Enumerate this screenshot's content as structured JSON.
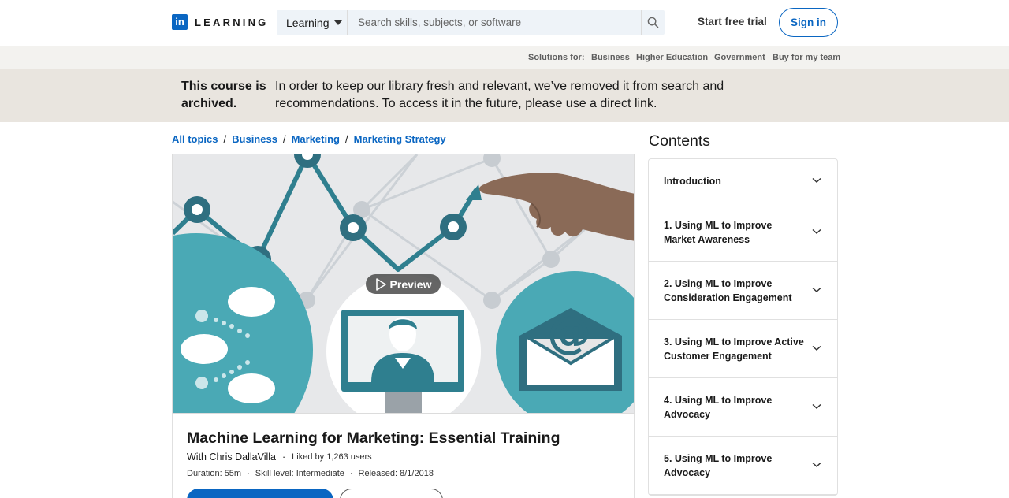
{
  "header": {
    "logo_mark": "in",
    "logo_text": "LEARNING",
    "search_scope": "Learning",
    "search_placeholder": "Search skills, subjects, or software",
    "start_trial": "Start free trial",
    "sign_in": "Sign in"
  },
  "solutions": {
    "label": "Solutions for:",
    "links": [
      "Business",
      "Higher Education",
      "Government",
      "Buy for my team"
    ]
  },
  "banner": {
    "title": "This course is archived.",
    "message": "In order to keep our library fresh and relevant, we’ve removed it from search and recommendations. To access it in the future, please use a direct link."
  },
  "breadcrumb": [
    "All topics",
    "Business",
    "Marketing",
    "Marketing Strategy"
  ],
  "hero": {
    "preview_label": "Preview"
  },
  "course": {
    "title": "Machine Learning for Marketing: Essential Training",
    "instructor": "With Chris DallaVilla",
    "likes": "Liked by 1,263 users",
    "duration": "Duration: 55m",
    "skill_level": "Skill level: Intermediate",
    "released": "Released: 8/1/2018"
  },
  "contents": {
    "heading": "Contents",
    "items": [
      "Introduction",
      "1. Using ML to Improve Market Awareness",
      "2. Using ML to Improve Consideration Engagement",
      "3. Using ML to Improve Active Customer Engagement",
      "4. Using ML to Improve Advocacy",
      "5. Using ML to Improve Advocacy"
    ]
  },
  "colors": {
    "brand_blue": "#0a66c2",
    "teal": "#4aa9b5",
    "dark_teal": "#2f6f80",
    "banner_bg": "#e9e5df"
  }
}
